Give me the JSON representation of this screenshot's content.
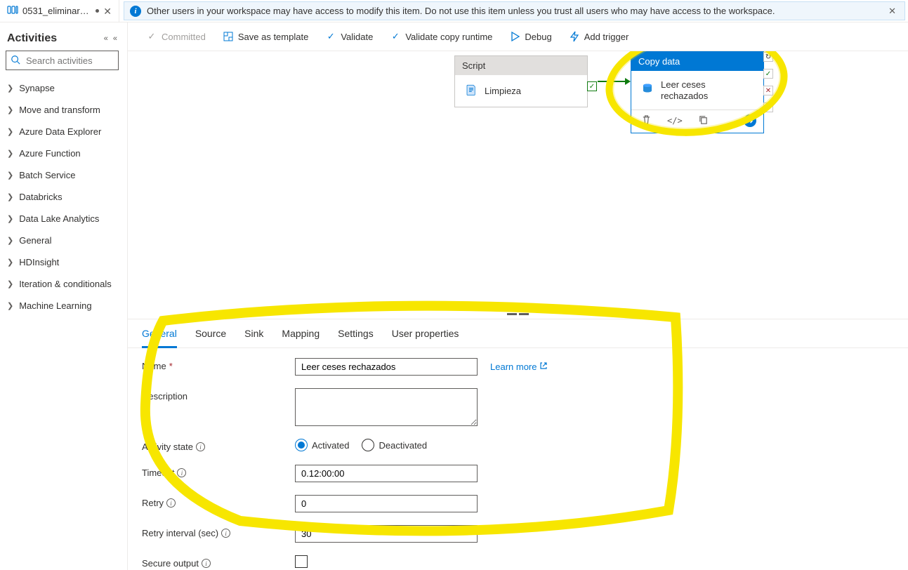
{
  "tab": {
    "title": "0531_eliminar_cese..."
  },
  "banner": {
    "text": "Other users in your workspace may have access to modify this item. Do not use this item unless you trust all users who may have access to the workspace."
  },
  "sidebar": {
    "title": "Activities",
    "search_placeholder": "Search activities",
    "items": [
      {
        "label": "Synapse"
      },
      {
        "label": "Move and transform"
      },
      {
        "label": "Azure Data Explorer"
      },
      {
        "label": "Azure Function"
      },
      {
        "label": "Batch Service"
      },
      {
        "label": "Databricks"
      },
      {
        "label": "Data Lake Analytics"
      },
      {
        "label": "General"
      },
      {
        "label": "HDInsight"
      },
      {
        "label": "Iteration & conditionals"
      },
      {
        "label": "Machine Learning"
      }
    ]
  },
  "toolbar": {
    "committed": "Committed",
    "save_template": "Save as template",
    "validate": "Validate",
    "validate_copy": "Validate copy runtime",
    "debug": "Debug",
    "add_trigger": "Add trigger"
  },
  "canvas": {
    "node1": {
      "type": "Script",
      "title": "Limpieza"
    },
    "node2": {
      "type": "Copy data",
      "title": "Leer ceses rechazados"
    }
  },
  "props": {
    "tabs": [
      "General",
      "Source",
      "Sink",
      "Mapping",
      "Settings",
      "User properties"
    ],
    "labels": {
      "name": "Name",
      "description": "Description",
      "activity_state": "Activity state",
      "timeout": "Timeout",
      "retry": "Retry",
      "retry_interval": "Retry interval (sec)",
      "secure_output": "Secure output"
    },
    "values": {
      "name": "Leer ceses rechazados",
      "description": "",
      "timeout": "0.12:00:00",
      "retry": "0",
      "retry_interval": "30"
    },
    "radios": {
      "activated": "Activated",
      "deactivated": "Deactivated"
    },
    "learn_more": "Learn more"
  }
}
